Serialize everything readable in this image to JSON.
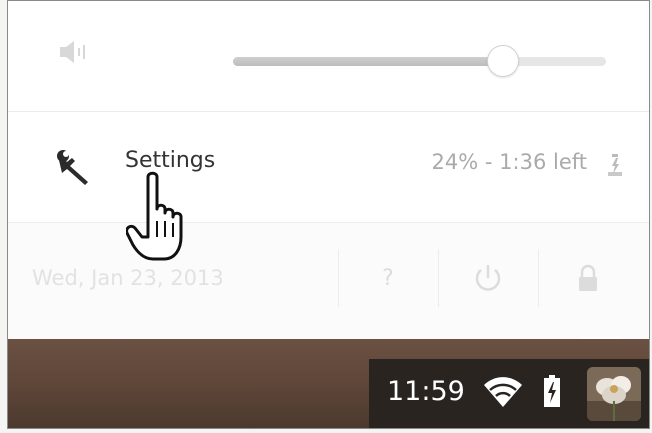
{
  "volume": {
    "level_percent": 72,
    "muted": false
  },
  "settings": {
    "label": "Settings"
  },
  "battery": {
    "status": "24% - 1:36 left"
  },
  "bottom": {
    "date": "Wed, Jan 23, 2013",
    "help_label": "?"
  },
  "shelf": {
    "clock": "11:59",
    "icons": [
      "wifi-icon",
      "battery-icon",
      "avatar"
    ]
  },
  "cursor": {
    "type": "hand-pointer"
  },
  "colors": {
    "shelf": "#5d4538",
    "tray": "#2a2421",
    "popup": "#ffffff",
    "text_dark": "#333333",
    "text_muted": "#aaaaaa"
  }
}
